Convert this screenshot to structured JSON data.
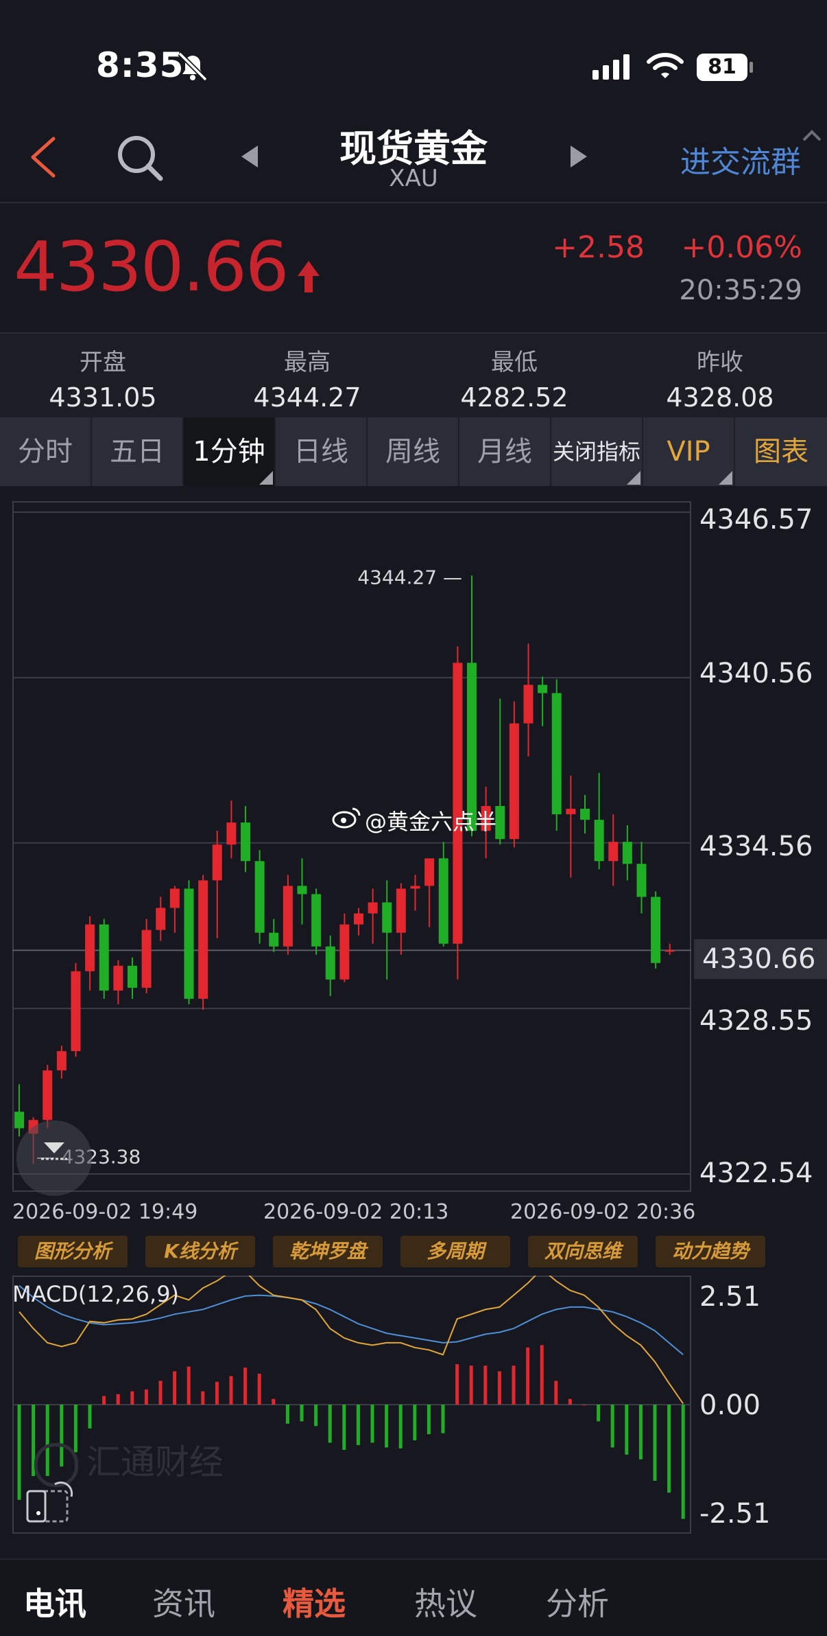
{
  "status_bar": {
    "time": "8:35",
    "battery": "81"
  },
  "header": {
    "title": "现货黄金",
    "subtitle": "XAU",
    "join_label": "进交流群"
  },
  "quote": {
    "price": "4330.66",
    "change": "+2.58",
    "change_pct": "+0.06%",
    "time": "20:35:29"
  },
  "stats": [
    {
      "label": "开盘",
      "value": "4331.05"
    },
    {
      "label": "最高",
      "value": "4344.27"
    },
    {
      "label": "最低",
      "value": "4282.52"
    },
    {
      "label": "昨收",
      "value": "4328.08"
    }
  ],
  "tabs": [
    "分时",
    "五日",
    "1分钟",
    "日线",
    "周线",
    "月线",
    "关闭指标",
    "VIP",
    "图表"
  ],
  "colors": {
    "up": "#e3272f",
    "down": "#1fae26",
    "gold": "#e3a63a",
    "link": "#4f86d6"
  },
  "chart_data": [
    {
      "type": "candlestick",
      "title": "",
      "y_ticks": [
        "4346.57",
        "4340.56",
        "4334.56",
        "4330.66",
        "4328.55",
        "4322.54"
      ],
      "ylim": [
        4322.54,
        4346.57
      ],
      "last_price": "4330.66",
      "max_label": "4344.27",
      "min_label": "4323.38",
      "x_ticks": [
        "2026-09-02 19:49",
        "2026-09-02 20:13",
        "2026-09-02 20:36"
      ],
      "watermark": "@黄金六点半",
      "candles": [
        {
          "o": 4324.8,
          "h": 4325.8,
          "l": 4323.9,
          "c": 4324.2
        },
        {
          "o": 4324.0,
          "h": 4324.6,
          "l": 4322.9,
          "c": 4324.5
        },
        {
          "o": 4324.5,
          "h": 4326.5,
          "l": 4324.2,
          "c": 4326.3
        },
        {
          "o": 4326.3,
          "h": 4327.2,
          "l": 4326.0,
          "c": 4327.0
        },
        {
          "o": 4327.0,
          "h": 4330.2,
          "l": 4326.8,
          "c": 4329.9
        },
        {
          "o": 4329.9,
          "h": 4331.9,
          "l": 4329.2,
          "c": 4331.6
        },
        {
          "o": 4331.6,
          "h": 4331.8,
          "l": 4328.9,
          "c": 4329.2
        },
        {
          "o": 4329.2,
          "h": 4330.3,
          "l": 4328.7,
          "c": 4330.1
        },
        {
          "o": 4330.1,
          "h": 4330.4,
          "l": 4328.9,
          "c": 4329.3
        },
        {
          "o": 4329.3,
          "h": 4331.8,
          "l": 4329.1,
          "c": 4331.4
        },
        {
          "o": 4331.4,
          "h": 4332.6,
          "l": 4331.0,
          "c": 4332.2
        },
        {
          "o": 4332.2,
          "h": 4333.0,
          "l": 4331.3,
          "c": 4332.9
        },
        {
          "o": 4332.9,
          "h": 4333.2,
          "l": 4328.7,
          "c": 4328.9
        },
        {
          "o": 4328.9,
          "h": 4333.4,
          "l": 4328.5,
          "c": 4333.2
        },
        {
          "o": 4333.2,
          "h": 4335.0,
          "l": 4331.1,
          "c": 4334.5
        },
        {
          "o": 4334.5,
          "h": 4336.1,
          "l": 4334.0,
          "c": 4335.3
        },
        {
          "o": 4335.3,
          "h": 4335.9,
          "l": 4333.5,
          "c": 4333.9
        },
        {
          "o": 4333.9,
          "h": 4334.3,
          "l": 4330.9,
          "c": 4331.3
        },
        {
          "o": 4331.3,
          "h": 4331.8,
          "l": 4330.6,
          "c": 4330.8
        },
        {
          "o": 4330.8,
          "h": 4333.4,
          "l": 4330.5,
          "c": 4333.0
        },
        {
          "o": 4333.0,
          "h": 4334.0,
          "l": 4331.6,
          "c": 4332.7
        },
        {
          "o": 4332.7,
          "h": 4332.9,
          "l": 4330.5,
          "c": 4330.8
        },
        {
          "o": 4330.8,
          "h": 4331.2,
          "l": 4329.0,
          "c": 4329.6
        },
        {
          "o": 4329.6,
          "h": 4332.0,
          "l": 4329.5,
          "c": 4331.6
        },
        {
          "o": 4331.6,
          "h": 4332.2,
          "l": 4331.2,
          "c": 4332.0
        },
        {
          "o": 4332.0,
          "h": 4332.9,
          "l": 4330.9,
          "c": 4332.4
        },
        {
          "o": 4332.4,
          "h": 4333.2,
          "l": 4329.6,
          "c": 4331.3
        },
        {
          "o": 4331.3,
          "h": 4333.1,
          "l": 4330.5,
          "c": 4332.9
        },
        {
          "o": 4332.9,
          "h": 4333.4,
          "l": 4332.1,
          "c": 4333.0
        },
        {
          "o": 4333.0,
          "h": 4333.9,
          "l": 4331.5,
          "c": 4334.0
        },
        {
          "o": 4334.0,
          "h": 4334.6,
          "l": 4330.8,
          "c": 4330.9
        },
        {
          "o": 4330.9,
          "h": 4341.7,
          "l": 4329.6,
          "c": 4341.1
        },
        {
          "o": 4341.1,
          "h": 4344.27,
          "l": 4334.8,
          "c": 4335.0
        },
        {
          "o": 4335.0,
          "h": 4336.6,
          "l": 4334.0,
          "c": 4335.9
        },
        {
          "o": 4335.9,
          "h": 4339.8,
          "l": 4334.5,
          "c": 4334.7
        },
        {
          "o": 4334.7,
          "h": 4339.7,
          "l": 4334.4,
          "c": 4338.9
        },
        {
          "o": 4338.9,
          "h": 4341.8,
          "l": 4337.7,
          "c": 4340.3
        },
        {
          "o": 4340.3,
          "h": 4340.6,
          "l": 4338.8,
          "c": 4340.0
        },
        {
          "o": 4340.0,
          "h": 4340.5,
          "l": 4335.0,
          "c": 4335.6
        },
        {
          "o": 4335.6,
          "h": 4337.0,
          "l": 4333.3,
          "c": 4335.8
        },
        {
          "o": 4335.8,
          "h": 4336.3,
          "l": 4334.9,
          "c": 4335.4
        },
        {
          "o": 4335.4,
          "h": 4337.1,
          "l": 4333.6,
          "c": 4333.9
        },
        {
          "o": 4333.9,
          "h": 4335.6,
          "l": 4333.0,
          "c": 4334.6
        },
        {
          "o": 4334.6,
          "h": 4335.2,
          "l": 4333.2,
          "c": 4333.8
        },
        {
          "o": 4333.8,
          "h": 4334.6,
          "l": 4332.0,
          "c": 4332.6
        },
        {
          "o": 4332.6,
          "h": 4332.8,
          "l": 4330.0,
          "c": 4330.2
        },
        {
          "o": 4330.66,
          "h": 4330.9,
          "l": 4330.5,
          "c": 4330.66
        }
      ]
    },
    {
      "type": "macd",
      "title": "MACD(12,26,9)",
      "y_ticks": [
        "2.51",
        "0.00",
        "-2.51"
      ],
      "ylim": [
        -2.51,
        2.51
      ],
      "dif": [
        1.95,
        1.6,
        1.3,
        1.22,
        1.3,
        1.75,
        1.72,
        1.78,
        1.8,
        1.9,
        2.1,
        2.3,
        2.2,
        2.45,
        2.6,
        2.8,
        2.8,
        2.5,
        2.3,
        2.25,
        2.2,
        2.0,
        1.6,
        1.4,
        1.3,
        1.25,
        1.3,
        1.3,
        1.2,
        1.15,
        1.05,
        1.8,
        1.9,
        2.0,
        2.05,
        2.3,
        2.55,
        2.85,
        2.6,
        2.4,
        2.3,
        2.05,
        1.7,
        1.45,
        1.25,
        0.9,
        0.45,
        0.02
      ],
      "dea": [
        2.5,
        2.25,
        2.05,
        1.9,
        1.8,
        1.72,
        1.68,
        1.7,
        1.72,
        1.76,
        1.82,
        1.9,
        1.95,
        2.0,
        2.1,
        2.2,
        2.28,
        2.3,
        2.28,
        2.25,
        2.2,
        2.12,
        2.0,
        1.85,
        1.7,
        1.6,
        1.5,
        1.45,
        1.4,
        1.35,
        1.3,
        1.32,
        1.4,
        1.48,
        1.52,
        1.6,
        1.75,
        1.9,
        2.0,
        2.05,
        2.05,
        2.0,
        1.95,
        1.85,
        1.72,
        1.55,
        1.3,
        1.05
      ],
      "hist": [
        -2.0,
        -1.5,
        -1.5,
        -1.3,
        -1.0,
        -0.5,
        0.18,
        0.22,
        0.28,
        0.32,
        0.5,
        0.7,
        0.8,
        0.28,
        0.48,
        0.6,
        0.78,
        0.65,
        0.12,
        -0.4,
        -0.35,
        -0.45,
        -0.8,
        -0.95,
        -0.85,
        -0.8,
        -0.9,
        -0.92,
        -0.75,
        -0.62,
        -0.6,
        0.85,
        0.82,
        0.82,
        0.7,
        0.82,
        1.2,
        1.25,
        0.5,
        0.12,
        0.0,
        -0.35,
        -0.9,
        -1.05,
        -1.15,
        -1.6,
        -1.85,
        -2.4
      ]
    }
  ],
  "feature_buttons": [
    "图形分析",
    "K线分析",
    "乾坤罗盘",
    "多周期",
    "双向思维",
    "动力趋势"
  ],
  "chart_watermark": "汇通财经",
  "bottom_nav": [
    "电讯",
    "资讯",
    "精选",
    "热议",
    "分析"
  ]
}
